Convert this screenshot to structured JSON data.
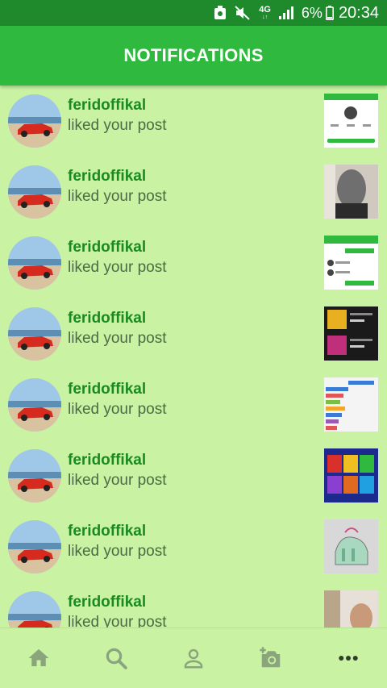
{
  "status_bar": {
    "icons": [
      "screenshot-icon",
      "mute-icon",
      "4g-icon",
      "signal-icon"
    ],
    "network_label": "4G",
    "battery": "6%",
    "time": "20:34"
  },
  "app_bar": {
    "title": "NOTIFICATIONS"
  },
  "notifications": [
    {
      "username": "feridoffikal",
      "message": "liked your post",
      "thumbnail": "profile-screenshot"
    },
    {
      "username": "feridoffikal",
      "message": "liked your post",
      "thumbnail": "masked-person-photo"
    },
    {
      "username": "feridoffikal",
      "message": "liked your post",
      "thumbnail": "chat-screenshot"
    },
    {
      "username": "feridoffikal",
      "message": "liked your post",
      "thumbnail": "music-app-screenshot"
    },
    {
      "username": "feridoffikal",
      "message": "liked your post",
      "thumbnail": "colored-bars-screenshot"
    },
    {
      "username": "feridoffikal",
      "message": "liked your post",
      "thumbnail": "game-screenshot"
    },
    {
      "username": "feridoffikal",
      "message": "liked your post",
      "thumbnail": "drawing-photo"
    },
    {
      "username": "feridoffikal",
      "message": "liked your post",
      "thumbnail": "person-photo"
    }
  ],
  "bottom_nav": {
    "items": [
      "home-icon",
      "search-icon",
      "profile-icon",
      "add-photo-icon",
      "more-icon"
    ]
  },
  "colors": {
    "status_bar": "#1f8a2c",
    "app_bar": "#2fb93f",
    "background": "#c9f2a3",
    "username": "#1a8a1f",
    "message": "#4d6b46",
    "nav_icon": "#8aa57c"
  }
}
